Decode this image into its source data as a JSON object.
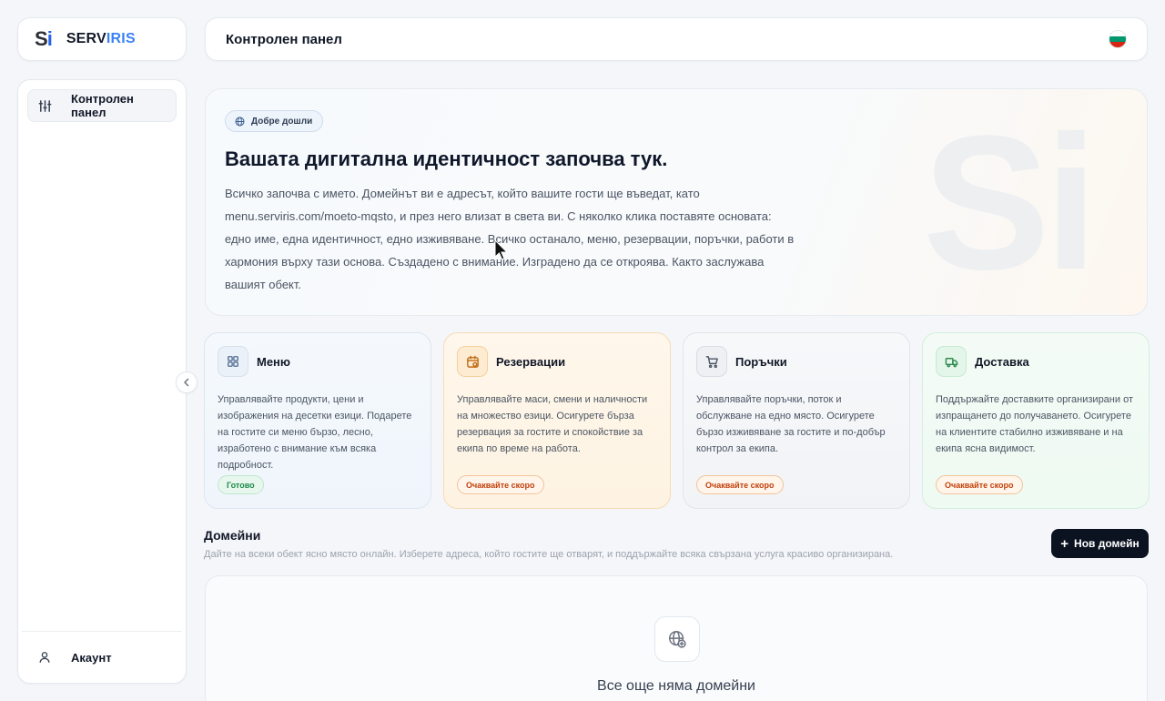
{
  "brand": {
    "mark_s": "S",
    "mark_i": "i",
    "name_part1": "SERV",
    "name_part2": "IRIS",
    "accent": "#3b82f6"
  },
  "header": {
    "title": "Контролен панел",
    "language_flag": "bulgaria-flag"
  },
  "sidebar": {
    "items": [
      {
        "label": "Контролен панел",
        "icon": "sliders-icon",
        "active": true
      }
    ],
    "bottom": {
      "label": "Акаунт",
      "icon": "user-icon"
    }
  },
  "hero": {
    "badge": "Добре дошли",
    "title": "Вашата дигитална идентичност започва тук.",
    "text": "Всичко започва с името. Домейнът ви е адресът, който вашите гости ще въведат, като menu.serviris.com/moeto-mqsto, и през него влизат в света ви. С няколко клика поставяте основата: едно име, една идентичност, едно изживяване. Всичко останало, меню, резервации, поръчки, работи в хармония върху тази основа. Създадено с внимание. Изградено да се откроява. Както заслужава вашият обект.",
    "watermark": "Si"
  },
  "features": [
    {
      "title": "Меню",
      "icon": "grid-icon",
      "description": "Управлявайте продукти, цени и изображения на десетки езици. Подарете на гостите си меню бързо, лесно, изработено с внимание към всяка подробност.",
      "status": "Готово",
      "status_type": "ready"
    },
    {
      "title": "Резервации",
      "icon": "calendar-icon",
      "description": "Управлявайте маси, смени и наличности на множество езици. Осигурете бърза резервация за гостите и спокойствие за екипа по време на работа.",
      "status": "Очаквайте скоро",
      "status_type": "soon"
    },
    {
      "title": "Поръчки",
      "icon": "cart-icon",
      "description": "Управлявайте поръчки, поток и обслужване на едно място. Осигурете бързо изживяване за гостите и по-добър контрол за екипа.",
      "status": "Очаквайте скоро",
      "status_type": "soon"
    },
    {
      "title": "Доставка",
      "icon": "truck-icon",
      "description": "Поддържайте доставките организирани от изпращането до получаването. Осигурете на клиентите стабилно изживяване и на екипа ясна видимост.",
      "status": "Очаквайте скоро",
      "status_type": "soon"
    }
  ],
  "domains": {
    "title": "Домейни",
    "subtitle": "Дайте на всеки обект ясно място онлайн. Изберете адреса, който гостите ще отварят, и поддържайте всяка свързана услуга красиво организирана.",
    "new_button": "Нов домейн",
    "empty_title": "Все още няма домейни"
  }
}
